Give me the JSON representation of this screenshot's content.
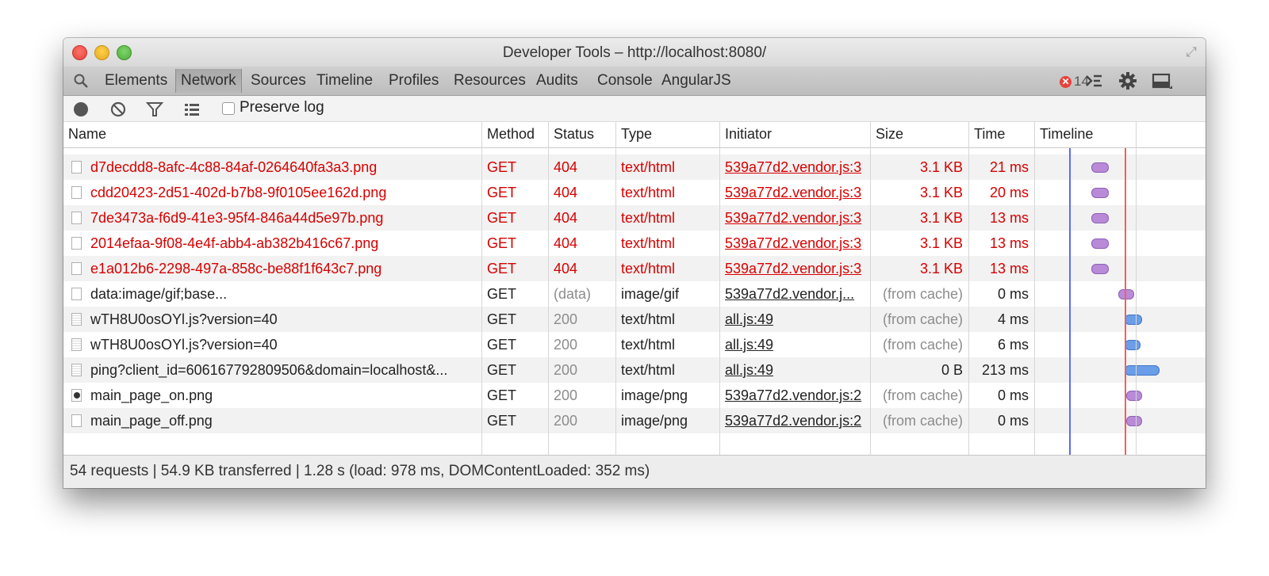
{
  "window": {
    "title": "Developer Tools – http://localhost:8080/"
  },
  "toolbar": {
    "tabs": [
      "Elements",
      "Network",
      "Sources",
      "Timeline",
      "Profiles",
      "Resources",
      "Audits",
      "Console",
      "AngularJS"
    ],
    "active_tab": "Network",
    "error_count": "14",
    "error_glyph": "✕"
  },
  "controls": {
    "preserve_log_label": "Preserve log",
    "preserve_log_checked": false
  },
  "table": {
    "columns": [
      "Name",
      "Method",
      "Status",
      "Type",
      "Initiator",
      "Size",
      "Time",
      "Timeline"
    ],
    "rows": [
      {
        "name": "d7decdd8-8afc-4c88-84af-0264640fa3a3.png",
        "method": "GET",
        "status": "404",
        "type": "text/html",
        "initiator": "539a77d2.vendor.js:3",
        "size": "3.1 KB",
        "time": "21 ms",
        "error": true,
        "icon": "document-icon"
      },
      {
        "name": "cdd20423-2d51-402d-b7b8-9f0105ee162d.png",
        "method": "GET",
        "status": "404",
        "type": "text/html",
        "initiator": "539a77d2.vendor.js:3",
        "size": "3.1 KB",
        "time": "20 ms",
        "error": true,
        "icon": "document-icon"
      },
      {
        "name": "7de3473a-f6d9-41e3-95f4-846a44d5e97b.png",
        "method": "GET",
        "status": "404",
        "type": "text/html",
        "initiator": "539a77d2.vendor.js:3",
        "size": "3.1 KB",
        "time": "13 ms",
        "error": true,
        "icon": "document-icon"
      },
      {
        "name": "2014efaa-9f08-4e4f-abb4-ab382b416c67.png",
        "method": "GET",
        "status": "404",
        "type": "text/html",
        "initiator": "539a77d2.vendor.js:3",
        "size": "3.1 KB",
        "time": "13 ms",
        "error": true,
        "icon": "document-icon"
      },
      {
        "name": "e1a012b6-2298-497a-858c-be88f1f643c7.png",
        "method": "GET",
        "status": "404",
        "type": "text/html",
        "initiator": "539a77d2.vendor.js:3",
        "size": "3.1 KB",
        "time": "13 ms",
        "error": true,
        "icon": "document-icon"
      },
      {
        "name": "data:image/gif;base...",
        "method": "GET",
        "status": "(data)",
        "type": "image/gif",
        "initiator": "539a77d2.vendor.j...",
        "size": "(from cache)",
        "time": "0 ms",
        "error": false,
        "icon": "image-icon"
      },
      {
        "name": "wTH8U0osOYl.js?version=40",
        "method": "GET",
        "status": "200",
        "type": "text/html",
        "initiator": "all.js:49",
        "size": "(from cache)",
        "time": "4 ms",
        "error": false,
        "icon": "script-icon"
      },
      {
        "name": "wTH8U0osOYl.js?version=40",
        "method": "GET",
        "status": "200",
        "type": "text/html",
        "initiator": "all.js:49",
        "size": "(from cache)",
        "time": "6 ms",
        "error": false,
        "icon": "script-icon"
      },
      {
        "name": "ping?client_id=606167792809506&domain=localhost&...",
        "method": "GET",
        "status": "200",
        "type": "text/html",
        "initiator": "all.js:49",
        "size": "0 B",
        "time": "213 ms",
        "error": false,
        "icon": "script-icon"
      },
      {
        "name": "main_page_on.png",
        "method": "GET",
        "status": "200",
        "type": "image/png",
        "initiator": "539a77d2.vendor.js:2",
        "size": "(from cache)",
        "time": "0 ms",
        "error": false,
        "icon": "image-icon"
      },
      {
        "name": "main_page_off.png",
        "method": "GET",
        "status": "200",
        "type": "image/png",
        "initiator": "539a77d2.vendor.js:2",
        "size": "(from cache)",
        "time": "0 ms",
        "error": false,
        "icon": "image-icon"
      }
    ]
  },
  "status": {
    "summary": "54 requests | 54.9 KB transferred | 1.28 s (load: 978 ms, DOMContentLoaded: 352 ms)"
  },
  "colors": {
    "error_red": "#d70000",
    "dom_loaded_line": "#5a6cf0",
    "load_line": "#f06060",
    "bubble_purple": "#b98ad8",
    "bubble_blue": "#6a9ee8"
  }
}
